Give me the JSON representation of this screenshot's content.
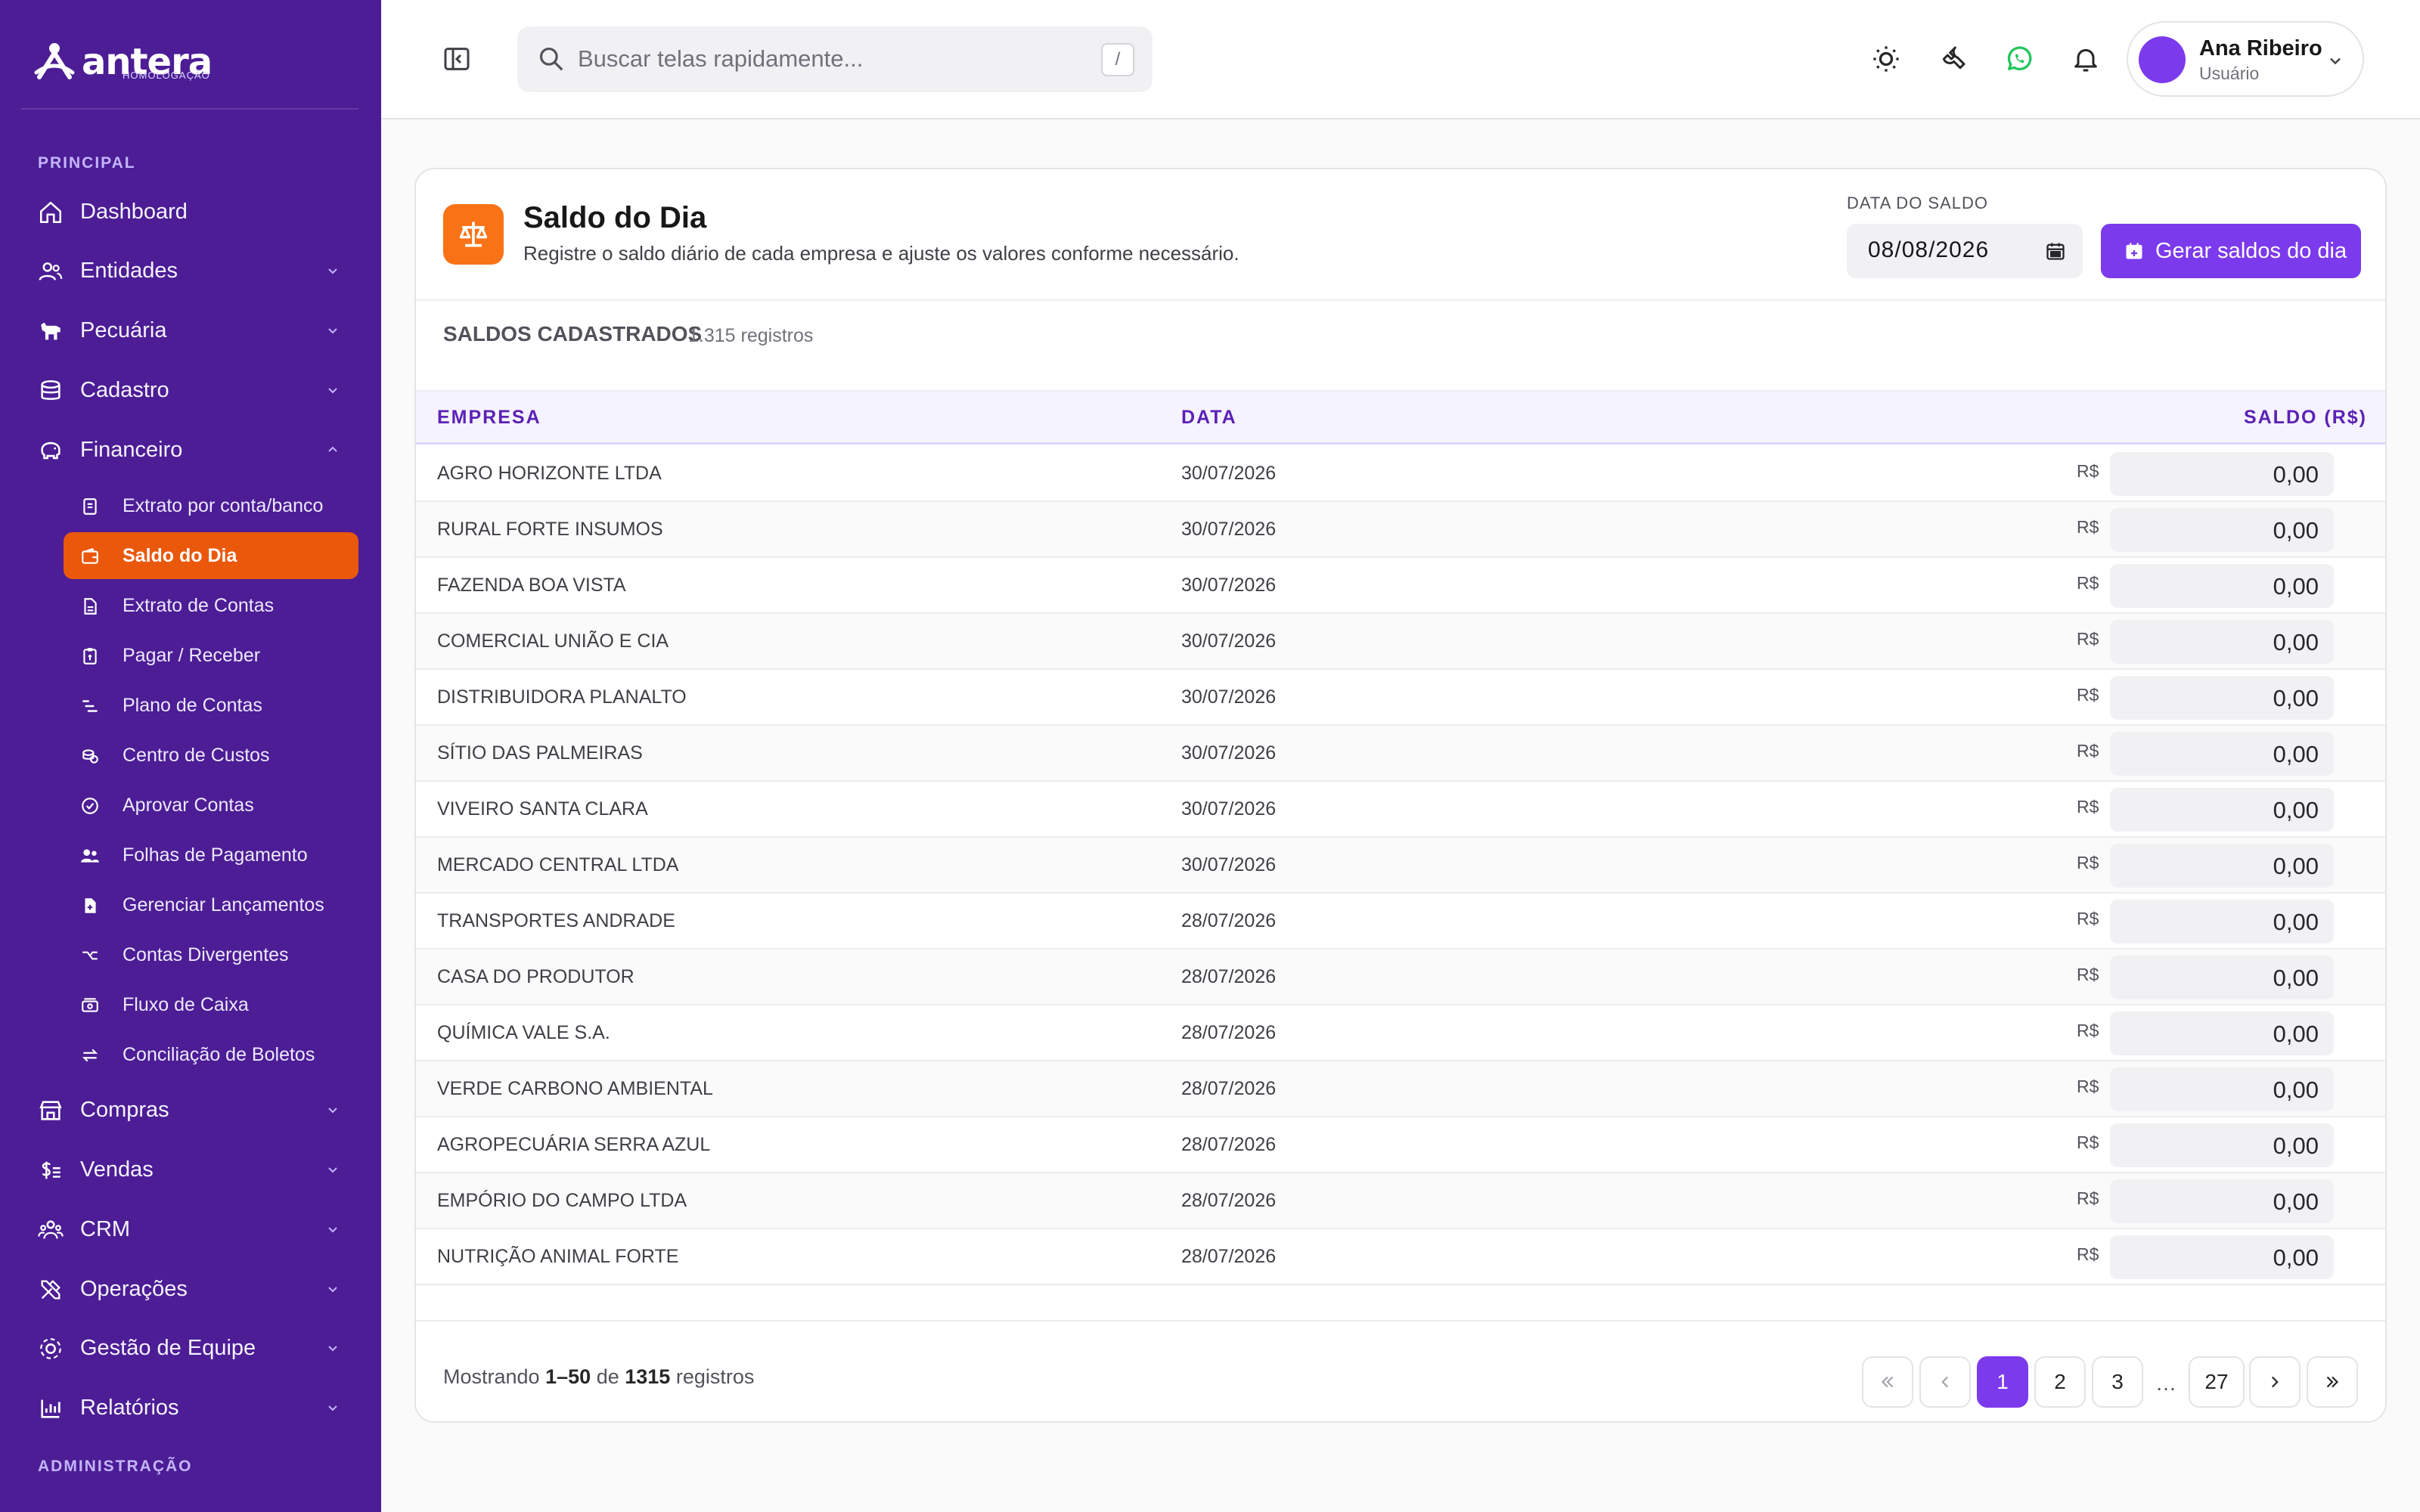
{
  "app": {
    "brand": "antera",
    "environment": "HOMOLOGAÇÃO"
  },
  "colors": {
    "sidebar": "#4c1d95",
    "accent": "#7c3aed",
    "active_item": "#ea580c",
    "page_icon": "#f97316",
    "whatsapp": "#22c55e"
  },
  "sidebar": {
    "section_main": "PRINCIPAL",
    "section_admin": "ADMINISTRAÇÃO",
    "items": [
      {
        "label": "Dashboard",
        "icon": "home-icon"
      },
      {
        "label": "Entidades",
        "icon": "users-icon"
      },
      {
        "label": "Pecuária",
        "icon": "cow-icon"
      },
      {
        "label": "Cadastro",
        "icon": "database-icon"
      },
      {
        "label": "Financeiro",
        "icon": "piggy-bank-icon"
      },
      {
        "label": "Compras",
        "icon": "store-icon"
      },
      {
        "label": "Vendas",
        "icon": "money-icon"
      },
      {
        "label": "CRM",
        "icon": "contacts-icon"
      },
      {
        "label": "Operações",
        "icon": "tools-icon"
      },
      {
        "label": "Gestão de Equipe",
        "icon": "team-icon"
      },
      {
        "label": "Relatórios",
        "icon": "chart-icon"
      }
    ],
    "financeiro_sub": [
      {
        "label": "Extrato por conta/banco",
        "icon": "statement-icon"
      },
      {
        "label": "Saldo do Dia",
        "icon": "wallet-icon",
        "active": true
      },
      {
        "label": "Extrato de Contas",
        "icon": "document-icon"
      },
      {
        "label": "Pagar / Receber",
        "icon": "clipboard-icon"
      },
      {
        "label": "Plano de Contas",
        "icon": "list-icon"
      },
      {
        "label": "Centro de Custos",
        "icon": "coins-icon"
      },
      {
        "label": "Aprovar Contas",
        "icon": "check-circle-icon"
      },
      {
        "label": "Folhas de Pagamento",
        "icon": "people-icon"
      },
      {
        "label": "Gerenciar Lançamentos",
        "icon": "file-plus-icon"
      },
      {
        "label": "Contas Divergentes",
        "icon": "split-icon"
      },
      {
        "label": "Fluxo de Caixa",
        "icon": "cash-icon"
      },
      {
        "label": "Conciliação de Boletos",
        "icon": "swap-icon"
      }
    ]
  },
  "header": {
    "search_placeholder": "Buscar telas rapidamente...",
    "search_shortcut": "/",
    "user": {
      "name": "Ana Ribeiro",
      "role": "Usuário"
    }
  },
  "page": {
    "title": "Saldo do Dia",
    "subtitle": "Registre o saldo diário de cada empresa e ajuste os valores conforme necessário.",
    "date_label": "DATA DO SALDO",
    "date_value": "08/08/2026",
    "generate_button": "Gerar saldos do dia",
    "list_title": "SALDOS CADASTRADOS",
    "list_count": "1.315 registros"
  },
  "table": {
    "columns": [
      "EMPRESA",
      "DATA",
      "SALDO (R$)"
    ],
    "currency": "R$",
    "rows": [
      {
        "empresa": "AGRO HORIZONTE LTDA",
        "data": "30/07/2026",
        "saldo": "0,00"
      },
      {
        "empresa": "RURAL FORTE INSUMOS",
        "data": "30/07/2026",
        "saldo": "0,00"
      },
      {
        "empresa": "FAZENDA BOA VISTA",
        "data": "30/07/2026",
        "saldo": "0,00"
      },
      {
        "empresa": "COMERCIAL UNIÃO E CIA",
        "data": "30/07/2026",
        "saldo": "0,00"
      },
      {
        "empresa": "DISTRIBUIDORA PLANALTO",
        "data": "30/07/2026",
        "saldo": "0,00"
      },
      {
        "empresa": "SÍTIO DAS PALMEIRAS",
        "data": "30/07/2026",
        "saldo": "0,00"
      },
      {
        "empresa": "VIVEIRO SANTA CLARA",
        "data": "30/07/2026",
        "saldo": "0,00"
      },
      {
        "empresa": "MERCADO CENTRAL LTDA",
        "data": "30/07/2026",
        "saldo": "0,00"
      },
      {
        "empresa": "TRANSPORTES ANDRADE",
        "data": "28/07/2026",
        "saldo": "0,00"
      },
      {
        "empresa": "CASA DO PRODUTOR",
        "data": "28/07/2026",
        "saldo": "0,00"
      },
      {
        "empresa": "QUÍMICA VALE S.A.",
        "data": "28/07/2026",
        "saldo": "0,00"
      },
      {
        "empresa": "VERDE CARBONO AMBIENTAL",
        "data": "28/07/2026",
        "saldo": "0,00"
      },
      {
        "empresa": "AGROPECUÁRIA SERRA AZUL",
        "data": "28/07/2026",
        "saldo": "0,00"
      },
      {
        "empresa": "EMPÓRIO DO CAMPO LTDA",
        "data": "28/07/2026",
        "saldo": "0,00"
      },
      {
        "empresa": "NUTRIÇÃO ANIMAL FORTE",
        "data": "28/07/2026",
        "saldo": "0,00"
      }
    ]
  },
  "pagination": {
    "prefix": "Mostrando",
    "range": "1–50",
    "of": "de",
    "total": "1315",
    "suffix": "registros",
    "pages": [
      "1",
      "2",
      "3"
    ],
    "ellipsis": "…",
    "last_page": "27",
    "current": "1"
  }
}
